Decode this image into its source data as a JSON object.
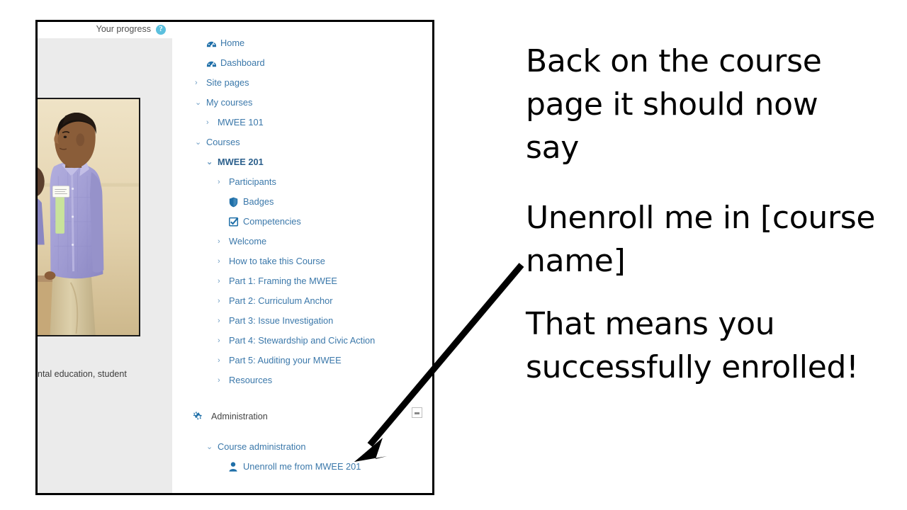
{
  "slide": {
    "narrative": [
      "Back on the course page it should now say",
      "Unenroll me in [course name]",
      "That means you successfully enrolled!"
    ]
  },
  "screenshot": {
    "left_panel": {
      "progress_label": "Your progress",
      "help_icon": "help-circle-icon",
      "photo_alt": "student-presenting-photo",
      "caption_partial": "ntal education, student"
    },
    "navigation": {
      "items": [
        {
          "label": "Home",
          "icon": "dashboard-icon",
          "caret": "",
          "level": 0,
          "bold": false
        },
        {
          "label": "Dashboard",
          "icon": "dashboard-icon",
          "caret": "",
          "level": 0,
          "bold": false
        },
        {
          "label": "Site pages",
          "icon": "",
          "caret": "right",
          "level": 0,
          "bold": false
        },
        {
          "label": "My courses",
          "icon": "",
          "caret": "down",
          "level": 0,
          "bold": false
        },
        {
          "label": "MWEE 101",
          "icon": "",
          "caret": "right",
          "level": 1,
          "bold": false
        },
        {
          "label": "Courses",
          "icon": "",
          "caret": "down",
          "level": 0,
          "bold": false
        },
        {
          "label": "MWEE 201",
          "icon": "",
          "caret": "down",
          "level": 1,
          "bold": true
        },
        {
          "label": "Participants",
          "icon": "",
          "caret": "right",
          "level": 2,
          "bold": false
        },
        {
          "label": "Badges",
          "icon": "shield-icon",
          "caret": "",
          "level": 2,
          "bold": false
        },
        {
          "label": "Competencies",
          "icon": "checkbox-checked-icon",
          "caret": "",
          "level": 2,
          "bold": false
        },
        {
          "label": "Welcome",
          "icon": "",
          "caret": "right",
          "level": 2,
          "bold": false
        },
        {
          "label": "How to take this Course",
          "icon": "",
          "caret": "right",
          "level": 2,
          "bold": false
        },
        {
          "label": "Part 1: Framing the MWEE",
          "icon": "",
          "caret": "right",
          "level": 2,
          "bold": false
        },
        {
          "label": "Part 2: Curriculum Anchor",
          "icon": "",
          "caret": "right",
          "level": 2,
          "bold": false
        },
        {
          "label": "Part 3: Issue Investigation",
          "icon": "",
          "caret": "right",
          "level": 2,
          "bold": false
        },
        {
          "label": "Part 4: Stewardship and Civic Action",
          "icon": "",
          "caret": "right",
          "level": 2,
          "bold": false
        },
        {
          "label": "Part 5: Auditing your MWEE",
          "icon": "",
          "caret": "right",
          "level": 2,
          "bold": false
        },
        {
          "label": "Resources",
          "icon": "",
          "caret": "right",
          "level": 2,
          "bold": false
        }
      ]
    },
    "administration": {
      "title": "Administration",
      "gear_icon": "gears-icon",
      "collapse_icon": "collapse-minus-icon",
      "items": [
        {
          "label": "Course administration",
          "icon": "",
          "caret": "down",
          "level": 1,
          "bold": false
        },
        {
          "label": "Unenroll me from MWEE 201",
          "icon": "user-icon",
          "caret": "",
          "level": 2,
          "bold": false
        }
      ]
    }
  },
  "colors": {
    "link_blue": "#3b78aa",
    "active_blue": "#2b5f8c",
    "icon_blue": "#1f6fa8",
    "help_cyan": "#5bc0de",
    "panel_gray": "#ebebeb",
    "text_black": "#000000"
  }
}
